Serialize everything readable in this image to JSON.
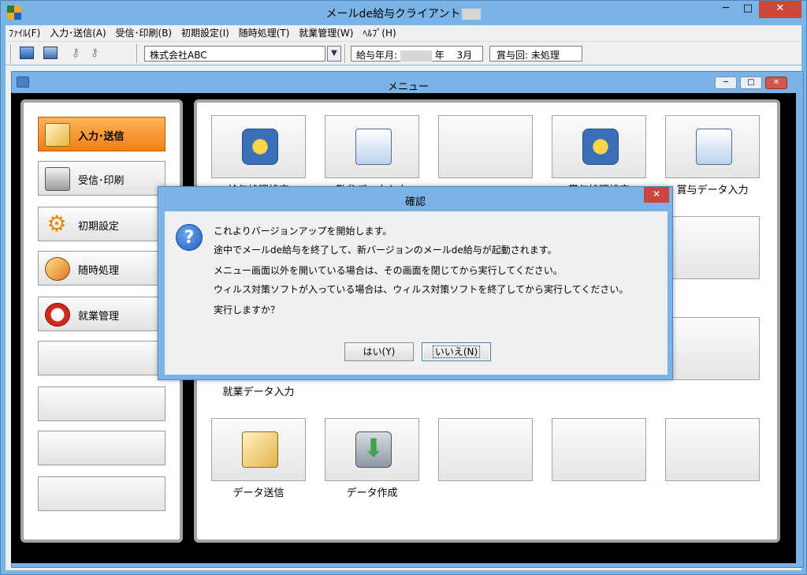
{
  "window": {
    "title": "メールde給与クライアント",
    "min": "─",
    "max": "□",
    "close": "✕"
  },
  "menu": [
    {
      "label": "ﾌｧｲﾙ(F)"
    },
    {
      "label": "入力･送信(A)"
    },
    {
      "label": "受信･印刷(B)"
    },
    {
      "label": "初期設定(I)"
    },
    {
      "label": "随時処理(T)"
    },
    {
      "label": "就業管理(W)"
    },
    {
      "label": "ﾍﾙﾌﾟ(H)"
    }
  ],
  "toolbar": {
    "company": "株式会社ABC",
    "company_dropdown": "▼",
    "pay_ym_label": "給与年月:",
    "pay_ym_year_suffix": "年",
    "pay_ym_month": "3月",
    "bonus_label": "賞与回:",
    "bonus_value": "未処理"
  },
  "mdi": {
    "title": "メニュー",
    "min": "─",
    "max": "□",
    "close": "✕"
  },
  "sidebar": {
    "items": [
      {
        "label": "入力･送信"
      },
      {
        "label": "受信･印刷"
      },
      {
        "label": "初期設定"
      },
      {
        "label": "随時処理"
      },
      {
        "label": "就業管理"
      }
    ]
  },
  "tiles": {
    "row1": [
      "給与処理設定",
      "勤怠データ入力",
      "",
      "賞与処理設定",
      "賞与データ入力"
    ],
    "row3_label": "就業データ入力",
    "row4": [
      "データ送信",
      "データ作成"
    ]
  },
  "dialog": {
    "title": "確認",
    "close": "✕",
    "icon": "?",
    "lines": [
      "これよりバージョンアップを開始します。",
      "途中でメールde給与を終了して、新バージョンのメールde給与が起動されます。",
      "メニュー画面以外を開いている場合は、その画面を閉じてから実行してください。",
      "ウィルス対策ソフトが入っている場合は、ウィルス対策ソフトを終了してから実行してください。",
      "実行しますか？"
    ],
    "yes": "はい(Y)",
    "no": "いいえ(N)"
  }
}
